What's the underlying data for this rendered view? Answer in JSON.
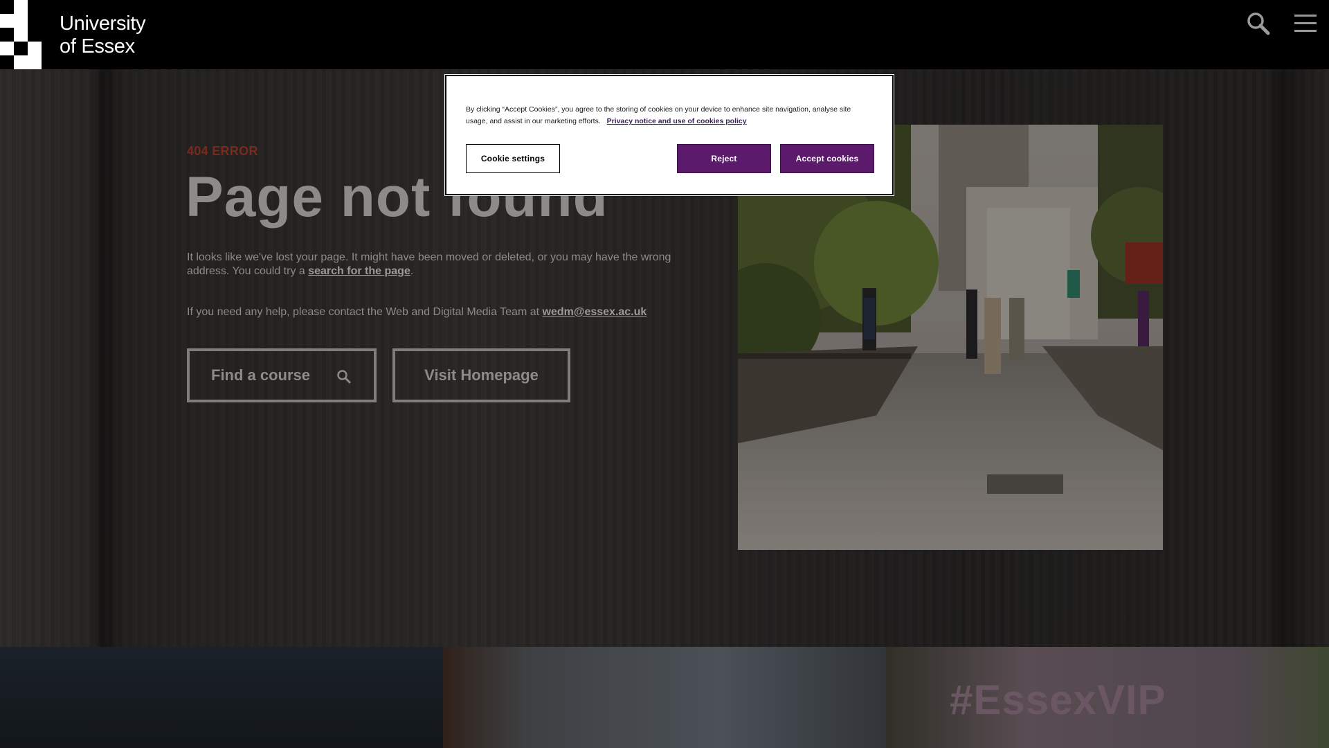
{
  "header": {
    "logo_line1": "University",
    "logo_line2": "of Essex",
    "icons": [
      "search-icon",
      "hamburger-menu-icon"
    ]
  },
  "error": {
    "label": "404 ERROR",
    "title": "Page not found",
    "body_text": "It looks like we've lost your page. It might have been moved or deleted, or you may have the wrong address. You could try a",
    "body_link": "search for the page",
    "body_end": ".",
    "help_text": "If you need any help, please contact the Web and Digital Media Team at",
    "help_email": "wedm@essex.ac.uk"
  },
  "buttons": {
    "find_course": "Find a course",
    "visit_homepage": "Visit Homepage"
  },
  "strip": {
    "hashtag": "#EssexVIP"
  },
  "cookie_banner": {
    "text": "By clicking “Accept Cookies”, you agree to the storing of cookies on your device to enhance site navigation, analyse site usage, and assist in our marketing efforts.",
    "policy_link": "Privacy notice and use of cookies policy",
    "settings_label": "Cookie settings",
    "reject_label": "Reject",
    "accept_label": "Accept cookies",
    "accent_color": "#5b1a6b"
  }
}
